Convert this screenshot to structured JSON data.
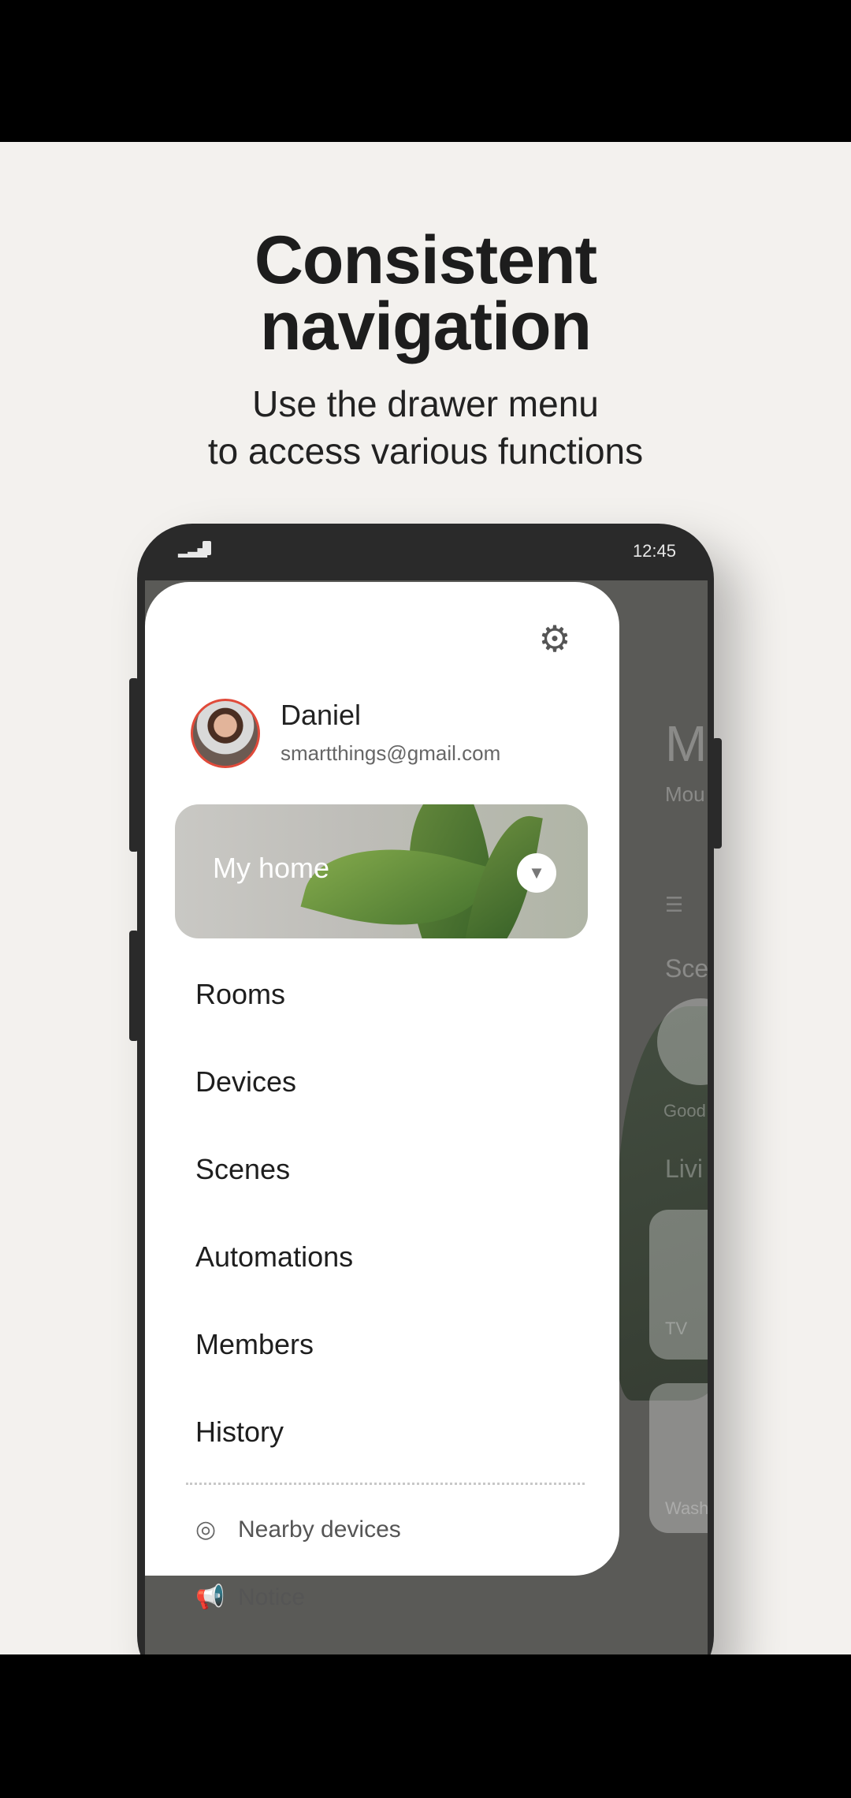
{
  "promo": {
    "headline_line1": "Consistent",
    "headline_line2": "navigation",
    "sub_line1": "Use the drawer menu",
    "sub_line2": "to access various functions"
  },
  "status_bar": {
    "time": "12:45"
  },
  "background_app": {
    "title_letter": "M",
    "subtitle_fragment": "Mou",
    "scenes_fragment": "Sce",
    "scene_label_fragment": "Good",
    "room_fragment": "Livi",
    "device1_fragment": "TV",
    "device2_fragment": "Wash"
  },
  "drawer": {
    "user": {
      "name": "Daniel",
      "email": "smartthings@gmail.com"
    },
    "home": {
      "label": "My home"
    },
    "menu": [
      {
        "label": "Rooms"
      },
      {
        "label": "Devices"
      },
      {
        "label": "Scenes"
      },
      {
        "label": "Automations"
      },
      {
        "label": "Members"
      },
      {
        "label": "History"
      }
    ],
    "secondary": [
      {
        "label": "Nearby devices",
        "icon": "nearby-icon"
      },
      {
        "label": "Notice",
        "icon": "megaphone-icon"
      }
    ]
  },
  "colors": {
    "avatar_ring": "#e04a3a",
    "background": "#f3f1ee"
  }
}
